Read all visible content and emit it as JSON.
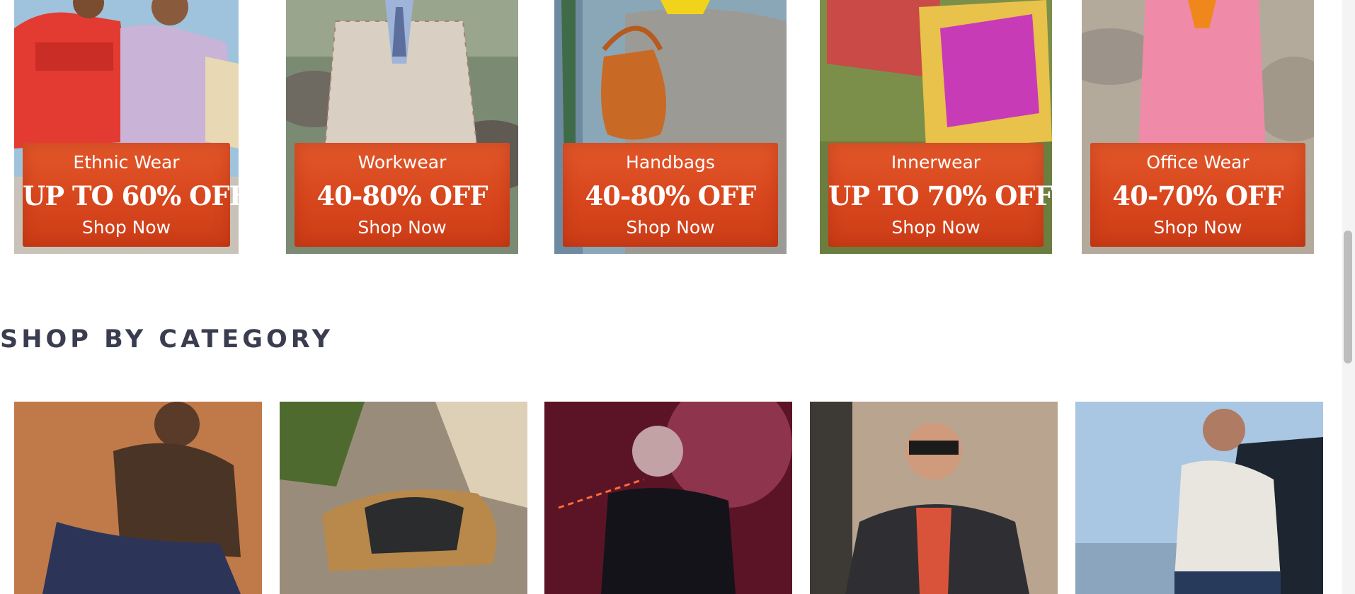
{
  "offers": [
    {
      "category": "Ethnic Wear",
      "discount": "UP TO 60% OFF",
      "cta": "Shop Now"
    },
    {
      "category": "Workwear",
      "discount": "40-80% OFF",
      "cta": "Shop Now"
    },
    {
      "category": "Handbags",
      "discount": "40-80% OFF",
      "cta": "Shop Now"
    },
    {
      "category": "Innerwear",
      "discount": "UP TO 70% OFF",
      "cta": "Shop Now"
    },
    {
      "category": "Office Wear",
      "discount": "40-70% OFF",
      "cta": "Shop Now"
    }
  ],
  "section": {
    "title": "SHOP BY CATEGORY"
  },
  "colors": {
    "banner": "#d8461d",
    "title": "#3a3d4f"
  }
}
